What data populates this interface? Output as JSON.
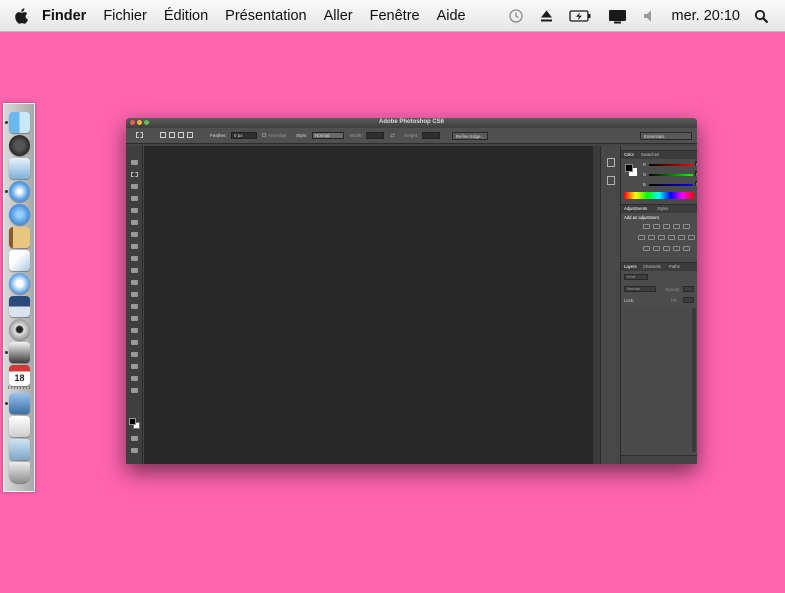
{
  "menubar": {
    "app_name": "Finder",
    "menus": [
      "Fichier",
      "Édition",
      "Présentation",
      "Aller",
      "Fenêtre",
      "Aide"
    ],
    "clock": "mer. 20:10",
    "icons": [
      "apple-icon",
      "time-machine-icon",
      "eject-icon",
      "battery-icon",
      "display-icon",
      "volume-icon",
      "spotlight-icon"
    ]
  },
  "desktop": {
    "background_color": "#ff64af"
  },
  "dock": {
    "icons": [
      "finder-icon",
      "dashboard-icon",
      "preview-icon",
      "safari-icon",
      "facetime-icon",
      "address-book-icon",
      "mail-icon",
      "itunes-icon",
      "mission-control-icon",
      "dvd-player-icon",
      "photo-booth-icon",
      "calendar-icon",
      "photoshop-icon",
      "textedit-icon",
      "downloads-folder-icon",
      "trash-icon"
    ],
    "calendar_day": "18"
  },
  "photoshop": {
    "title": "Adobe Photoshop CS6",
    "options": {
      "feather_label": "Feather:",
      "feather_value": "0 px",
      "anti_alias": "Anti-alias",
      "style_label": "Style:",
      "style_value": "Normal",
      "width_label": "Width:",
      "height_label": "Height:",
      "refine_edge": "Refine Edge...",
      "workspace": "Essentials"
    },
    "color_panel": {
      "tabs": [
        "Color",
        "Swatches"
      ],
      "channels": [
        "R",
        "G",
        "B"
      ],
      "values": [
        "0",
        "0",
        "0"
      ]
    },
    "adjustments_panel": {
      "tabs": [
        "Adjustments",
        "Styles"
      ],
      "heading": "Add an adjustment"
    },
    "layers_panel": {
      "tabs": [
        "Layers",
        "Channels",
        "Paths"
      ],
      "kind": "Kind",
      "blend_mode": "Normal",
      "opacity_label": "Opacity:",
      "lock_label": "Lock:",
      "fill_label": "Fill:"
    },
    "colors": {
      "window": "#454545",
      "canvas": "#282828",
      "panel": "#4c4c4c"
    }
  }
}
